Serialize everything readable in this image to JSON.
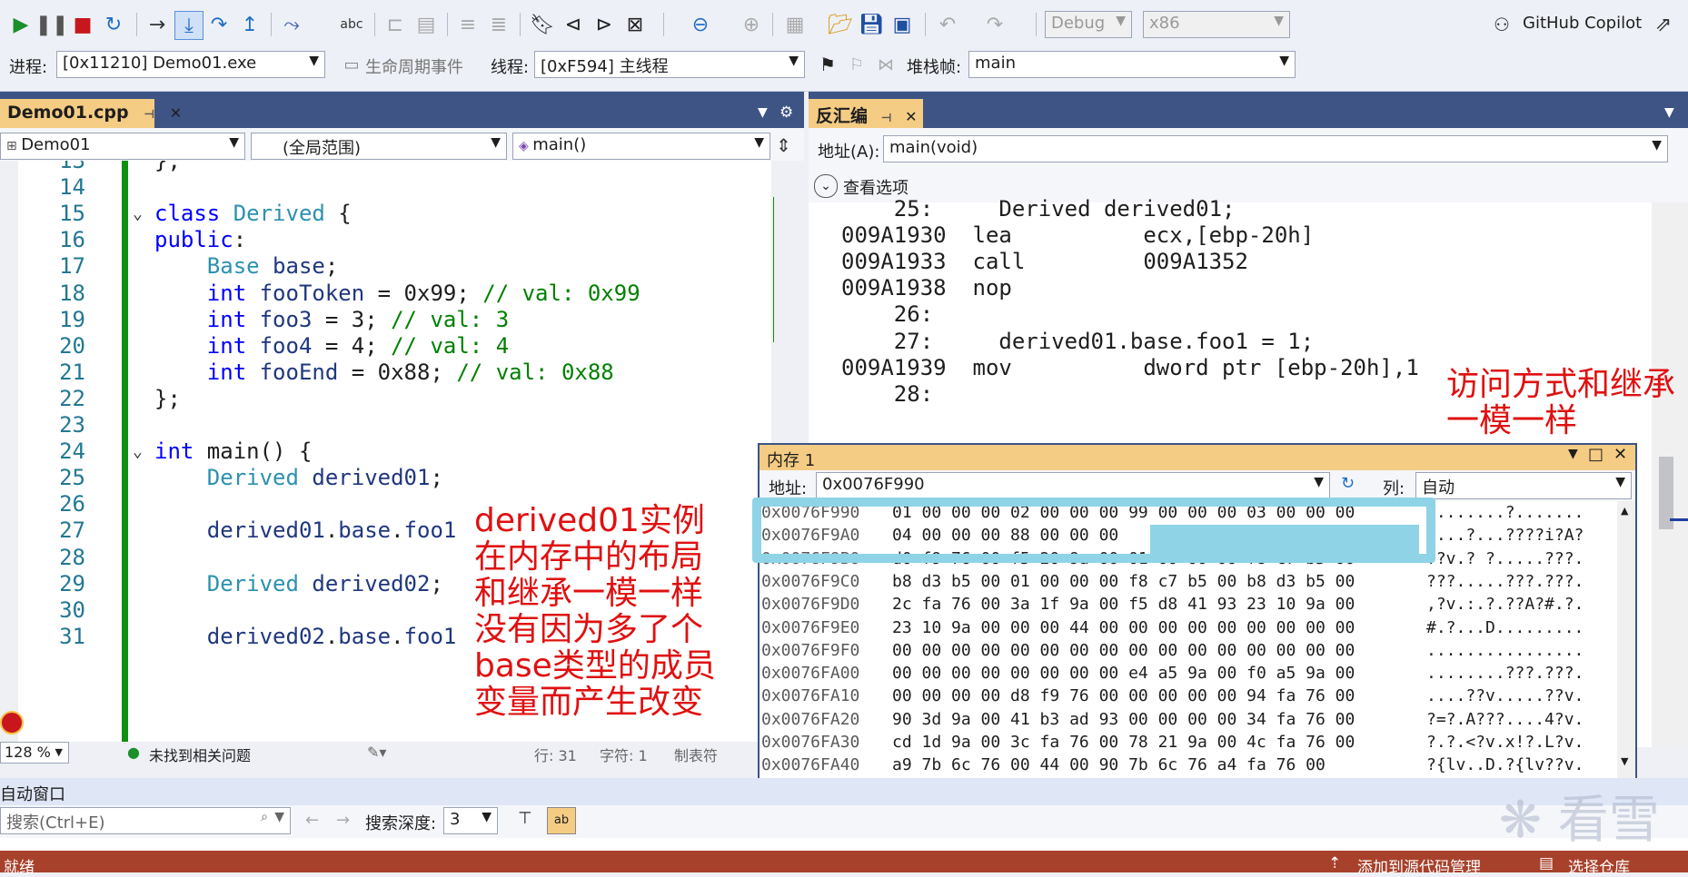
{
  "toolbar": {
    "config": "Debug",
    "platform": "x86",
    "copilot": "GitHub Copilot",
    "process_label": "进程:",
    "process_value": "[0x11210] Demo01.exe",
    "lifecycle_label": "生命周期事件",
    "thread_label": "线程:",
    "thread_value": "[0xF594] 主线程",
    "stackframe_label": "堆栈帧:",
    "stackframe_value": "main"
  },
  "editor": {
    "tab_label": "Demo01.cpp",
    "nav_project": "Demo01",
    "nav_scope": "(全局范围)",
    "nav_member": "main()",
    "lines": [
      {
        "n": "13",
        "code": "};"
      },
      {
        "n": "14",
        "code": ""
      },
      {
        "n": "15",
        "code": "class Derived {"
      },
      {
        "n": "16",
        "code": "public:"
      },
      {
        "n": "17",
        "code": "    Base base;"
      },
      {
        "n": "18",
        "code": "    int fooToken = 0x99; // val: 0x99"
      },
      {
        "n": "19",
        "code": "    int foo3 = 3; // val: 3"
      },
      {
        "n": "20",
        "code": "    int foo4 = 4; // val: 4"
      },
      {
        "n": "21",
        "code": "    int fooEnd = 0x88; // val: 0x88"
      },
      {
        "n": "22",
        "code": "};"
      },
      {
        "n": "23",
        "code": ""
      },
      {
        "n": "24",
        "code": "int main() {"
      },
      {
        "n": "25",
        "code": "    Derived derived01;"
      },
      {
        "n": "26",
        "code": ""
      },
      {
        "n": "27",
        "code": "    derived01.base.foo1"
      },
      {
        "n": "28",
        "code": ""
      },
      {
        "n": "29",
        "code": "    Derived derived02;"
      },
      {
        "n": "30",
        "code": ""
      },
      {
        "n": "31",
        "code": "    derived02.base.foo1"
      }
    ],
    "zoom": "128 %",
    "issues": "未找到相关问题",
    "row_col": "行: 31",
    "char_col": "字符: 1",
    "tabs_mode": "制表符"
  },
  "disasm": {
    "tab_label": "反汇编",
    "address_label": "地址(A):",
    "address_value": "main(void)",
    "view_options": "查看选项",
    "lines": [
      {
        "addr": "",
        "text": "    25:     Derived derived01;"
      },
      {
        "addr": "009A1930",
        "text": "lea          ecx,[ebp-20h]"
      },
      {
        "addr": "009A1933",
        "text": "call         009A1352"
      },
      {
        "addr": "009A1938",
        "text": "nop"
      },
      {
        "addr": "",
        "text": "    26:"
      },
      {
        "addr": "",
        "text": "    27:     derived01.base.foo1 = 1;"
      },
      {
        "addr": "009A1939",
        "text": "mov          dword ptr [ebp-20h],1"
      },
      {
        "addr": "",
        "text": "    28:"
      }
    ]
  },
  "memory": {
    "title": "内存 1",
    "address_label": "地址:",
    "address_value": "0x0076F990",
    "col_label": "列:",
    "col_value": "自动",
    "rows": [
      {
        "addr": "0x0076F990",
        "bytes": "01 00 00 00 02 00 00 00 99 00 00 00 03 00 00 00",
        "ascii": "........?......."
      },
      {
        "addr": "0x0076F9A0",
        "bytes": "04 00 00 00 88 00 00 00",
        "ascii": "....?...????i?A?"
      },
      {
        "addr": "0x0076F9B0",
        "bytes": "d0 f9 76 00 f5 20 9a 00 01 00 00 00 f8 c7 b5 00",
        "ascii": "??v.? ?.....???."
      },
      {
        "addr": "0x0076F9C0",
        "bytes": "b8 d3 b5 00 01 00 00 00 f8 c7 b5 00 b8 d3 b5 00",
        "ascii": "???.....???.???."
      },
      {
        "addr": "0x0076F9D0",
        "bytes": "2c fa 76 00 3a 1f 9a 00 f5 d8 41 93 23 10 9a 00",
        "ascii": ",?v.:.?.??A?#.?."
      },
      {
        "addr": "0x0076F9E0",
        "bytes": "23 10 9a 00 00 00 44 00 00 00 00 00 00 00 00 00",
        "ascii": "#.?...D........."
      },
      {
        "addr": "0x0076F9F0",
        "bytes": "00 00 00 00 00 00 00 00 00 00 00 00 00 00 00 00",
        "ascii": "................"
      },
      {
        "addr": "0x0076FA00",
        "bytes": "00 00 00 00 00 00 00 00 e4 a5 9a 00 f0 a5 9a 00",
        "ascii": "........???.???."
      },
      {
        "addr": "0x0076FA10",
        "bytes": "00 00 00 00 d8 f9 76 00 00 00 00 00 94 fa 76 00",
        "ascii": "....??v.....??v."
      },
      {
        "addr": "0x0076FA20",
        "bytes": "90 3d 9a 00 41 b3 ad 93 00 00 00 00 34 fa 76 00",
        "ascii": "?=?.A???....4?v."
      },
      {
        "addr": "0x0076FA30",
        "bytes": "cd 1d 9a 00 3c fa 76 00 78 21 9a 00 4c fa 76 00",
        "ascii": "?.?.<?v.x!?.L?v."
      },
      {
        "addr": "0x0076FA40",
        "bytes": "a9 7b 6c 76 00 44 00 90 7b 6c 76 a4 fa 76 00",
        "ascii": "?{lv..D.?{lv??v."
      }
    ]
  },
  "autos": {
    "title": "自动窗口",
    "search_placeholder": "搜索(Ctrl+E)",
    "depth_label": "搜索深度:",
    "depth_value": "3"
  },
  "statusbar": {
    "ready": "就绪",
    "source_control": "添加到源代码管理",
    "repo": "选择仓库"
  },
  "annotations": {
    "right": "访问方式和继承\n一模一样",
    "center": "derived01实例\n在内存中的布局\n和继承一模一样\n没有因为多了个\nbase类型的成员\n变量而产生改变"
  },
  "watermark": "看雪",
  "colors": {
    "accent_tab": "#f5cc84",
    "tab_strip": "#3d5485",
    "highlight": "#8fd3e6",
    "annotation": "#e01010",
    "statusbar": "#a8412b"
  }
}
